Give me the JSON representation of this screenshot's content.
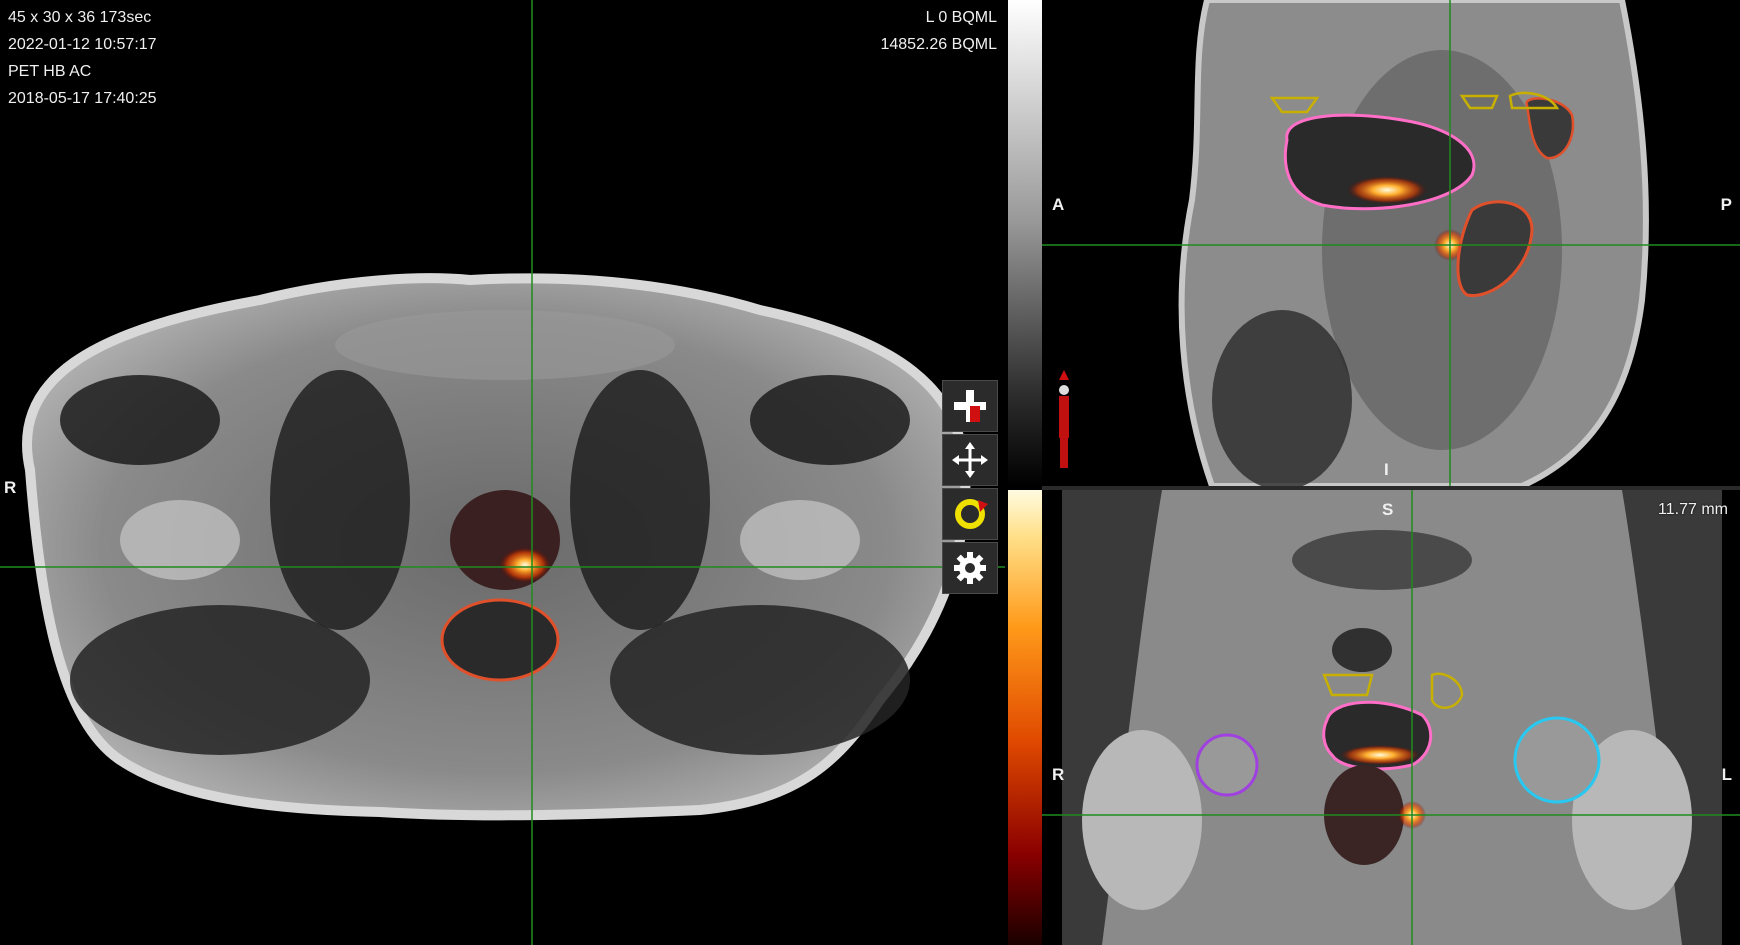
{
  "axial": {
    "info_lines": [
      "45 x 30 x 36 173sec",
      "2022-01-12 10:57:17",
      "PET HB AC",
      "2018-05-17 17:40:25"
    ],
    "window_lines": [
      "L 0 BQML",
      "14852.26 BQML"
    ],
    "orientation_left": "R"
  },
  "sagittal": {
    "orientation_left": "A",
    "orientation_right": "P",
    "orientation_bottom": "I"
  },
  "coronal": {
    "orientation_top": "S",
    "orientation_left": "R",
    "orientation_right": "L",
    "distance": "11.77 mm"
  },
  "toolbar": {
    "tools": [
      "add-tool",
      "pan-tool",
      "rotate-tool",
      "settings-tool"
    ]
  },
  "colors": {
    "crosshair": "#1f8a1f",
    "bladder_contour": "#ff6ec7",
    "rectum_contour": "#e0502a",
    "lymph_contour": "#c8b000",
    "femoral_left_contour": "#28c8f0",
    "femoral_right_contour": "#a040e0"
  }
}
